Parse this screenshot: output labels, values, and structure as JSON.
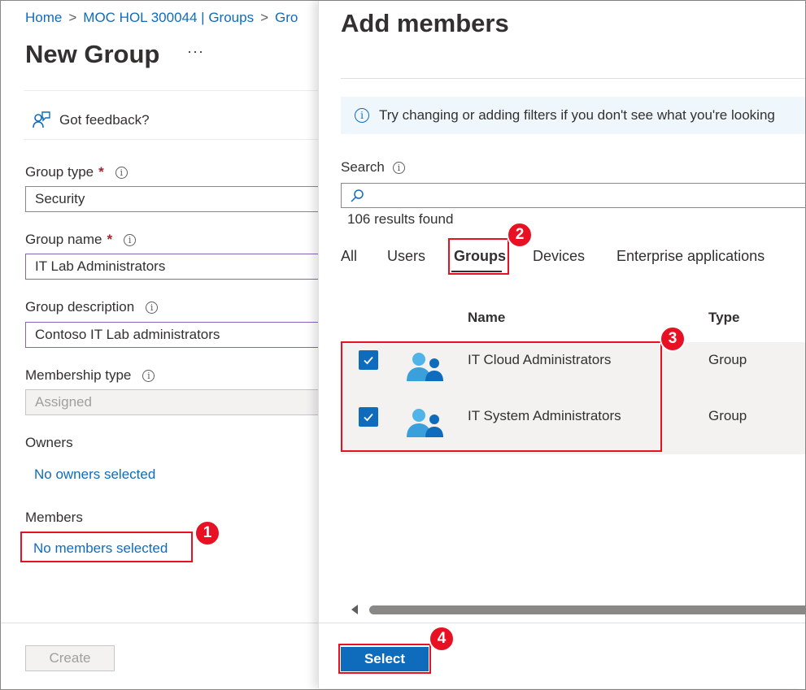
{
  "breadcrumb": {
    "home": "Home",
    "parent": "MOC HOL 300044 | Groups",
    "current": "Gro"
  },
  "page": {
    "title": "New Group",
    "more": "···"
  },
  "feedback": {
    "label": "Got feedback?"
  },
  "form": {
    "group_type_label": "Group type",
    "group_type_value": "Security",
    "group_name_label": "Group name",
    "group_name_value": "IT Lab Administrators",
    "group_desc_label": "Group description",
    "group_desc_value": "Contoso IT Lab administrators",
    "membership_label": "Membership type",
    "membership_value": "Assigned",
    "owners_label": "Owners",
    "owners_value": "No owners selected",
    "members_label": "Members",
    "members_value": "No members selected",
    "required_mark": "*"
  },
  "create_button": "Create",
  "panel": {
    "title": "Add members",
    "info_text": "Try changing or adding filters if you don't see what you're looking",
    "search_label": "Search",
    "search_placeholder": "",
    "results": "106 results found",
    "tabs": [
      "All",
      "Users",
      "Groups",
      "Devices",
      "Enterprise applications"
    ],
    "active_tab": "Groups",
    "columns": {
      "name": "Name",
      "type": "Type"
    },
    "rows": [
      {
        "name": "IT Cloud Administrators",
        "type": "Group",
        "checked": true
      },
      {
        "name": "IT System Administrators",
        "type": "Group",
        "checked": true
      }
    ],
    "select_button": "Select"
  },
  "callouts": [
    "1",
    "2",
    "3",
    "4"
  ],
  "colors": {
    "accent": "#0f6cbd",
    "callout": "#e81123",
    "required": "#a4262c"
  }
}
